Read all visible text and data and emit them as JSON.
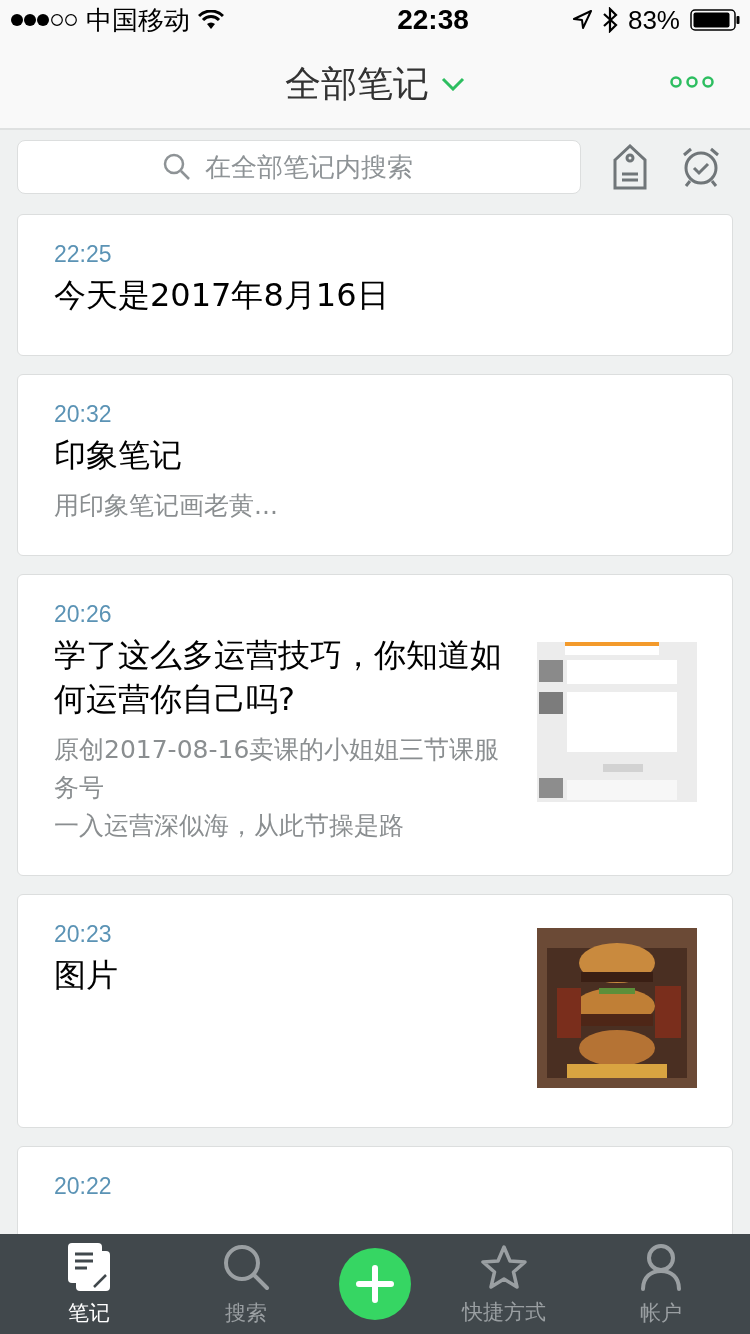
{
  "status_bar": {
    "carrier": "中国移动",
    "time": "22:38",
    "battery": "83%"
  },
  "nav": {
    "title": "全部笔记"
  },
  "search": {
    "placeholder": "在全部笔记内搜索"
  },
  "notes": [
    {
      "time": "22:25",
      "title": "今天是2017年8月16日"
    },
    {
      "time": "20:32",
      "title": "印象笔记",
      "snippet": [
        "用印象笔记画老黄..."
      ]
    },
    {
      "time": "20:26",
      "title": "学了这么多运营技巧，你知道如何运营你自己吗?",
      "snippet": [
        "原创2017-08-16卖课的小姐姐三节课服务号",
        "一入运营深似海，从此节操是路"
      ]
    },
    {
      "time": "20:23",
      "title": "图片"
    },
    {
      "time": "20:22"
    }
  ],
  "tabs": [
    {
      "kind": "notes",
      "label": "笔记",
      "selected": true
    },
    {
      "kind": "search",
      "label": "搜索",
      "selected": false
    },
    {
      "kind": "add"
    },
    {
      "kind": "star",
      "label": "快捷方式",
      "selected": false
    },
    {
      "kind": "account",
      "label": "帐户",
      "selected": false
    }
  ]
}
